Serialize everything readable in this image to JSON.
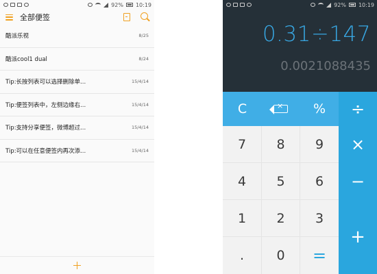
{
  "status_bar": {
    "battery": "92%",
    "time": "10:19"
  },
  "notes": {
    "title": "全部便签",
    "items": [
      {
        "text": "酷派乐视",
        "date": "8/25"
      },
      {
        "text": "酷派cool1 dual",
        "date": "8/24"
      },
      {
        "text": "Tip:长按列表可以选择删除单...",
        "date": "15/4/14"
      },
      {
        "text": "Tip:便签列表中，左侧边缘右...",
        "date": "15/4/14"
      },
      {
        "text": "Tip:支持分享便签，微博超过...",
        "date": "15/4/14"
      },
      {
        "text": "Tip:可以在任意便签内再次添...",
        "date": "15/4/14"
      }
    ],
    "add_icon": "plus-icon",
    "accent_color": "#f0a020"
  },
  "calculator": {
    "expression": "0.31÷147",
    "result": "0.0021088435",
    "keys": {
      "clear": "C",
      "percent": "%",
      "divide": "÷",
      "multiply": "×",
      "minus": "−",
      "plus": "+",
      "equals": "=",
      "dot": ".",
      "n0": "0",
      "n1": "1",
      "n2": "2",
      "n3": "3",
      "n4": "4",
      "n5": "5",
      "n6": "6",
      "n7": "7",
      "n8": "8",
      "n9": "9"
    },
    "display_color": "#253038",
    "accent_color": "#2aa6de"
  }
}
